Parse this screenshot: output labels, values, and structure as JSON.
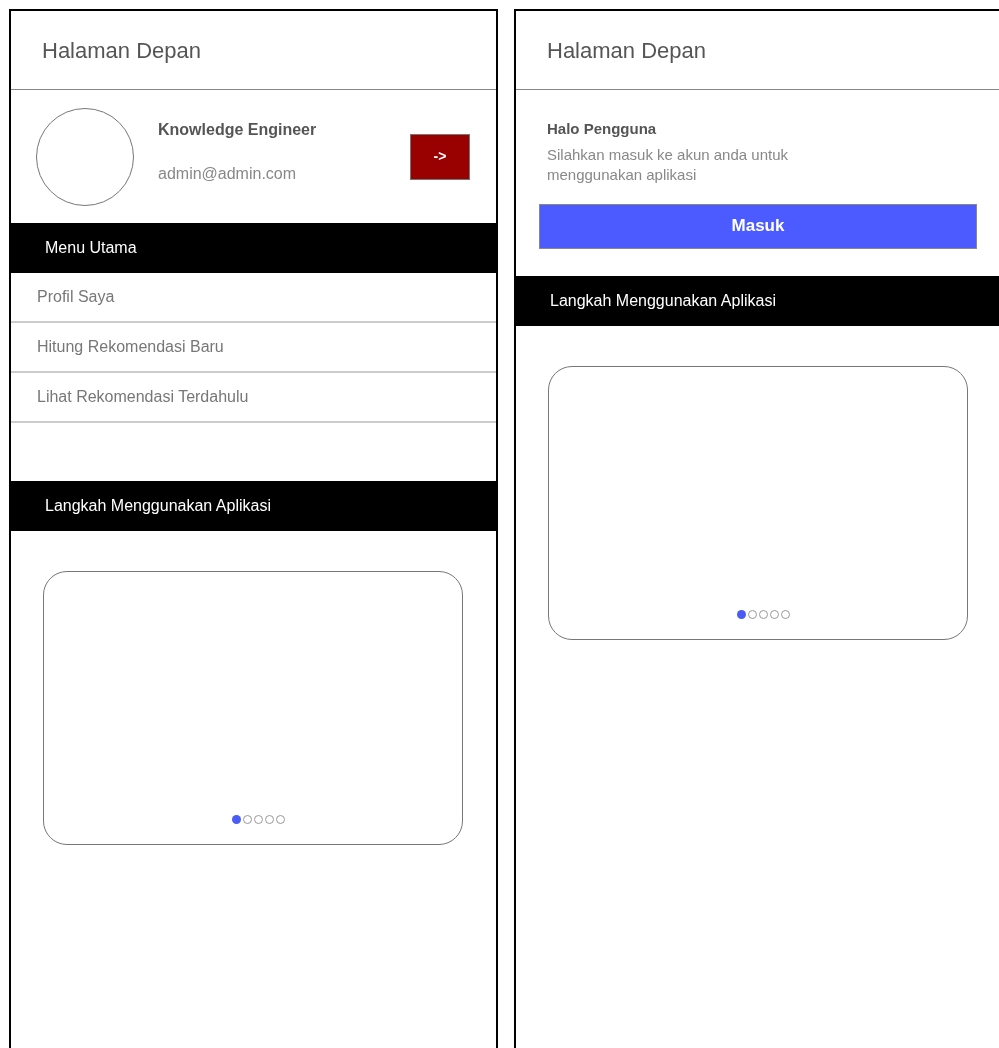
{
  "screens": [
    {
      "kind": "logged_in",
      "title": "Halaman Depan",
      "profile": {
        "name": "Knowledge Engineer",
        "email": "admin@admin.com",
        "button": "->"
      },
      "menu_heading": "Menu Utama",
      "menu_items": [
        "Profil Saya",
        "Hitung Rekomendasi Baru",
        "Lihat Rekomendasi Terdahulu"
      ],
      "steps_heading": "Langkah Menggunakan Aplikasi",
      "carousel_dots": [
        {
          "selected": true
        },
        {
          "selected": false
        },
        {
          "selected": false
        },
        {
          "selected": false
        },
        {
          "selected": false
        }
      ]
    },
    {
      "kind": "guest",
      "title": "Halaman Depan",
      "greeting": "Halo Pengguna",
      "message": "Silahkan masuk ke akun anda untuk menggunakan aplikasi",
      "login_button": "Masuk",
      "steps_heading": "Langkah Menggunakan Aplikasi",
      "carousel_dots": [
        {
          "selected": true
        },
        {
          "selected": false
        },
        {
          "selected": false
        },
        {
          "selected": false
        },
        {
          "selected": false
        }
      ]
    }
  ]
}
